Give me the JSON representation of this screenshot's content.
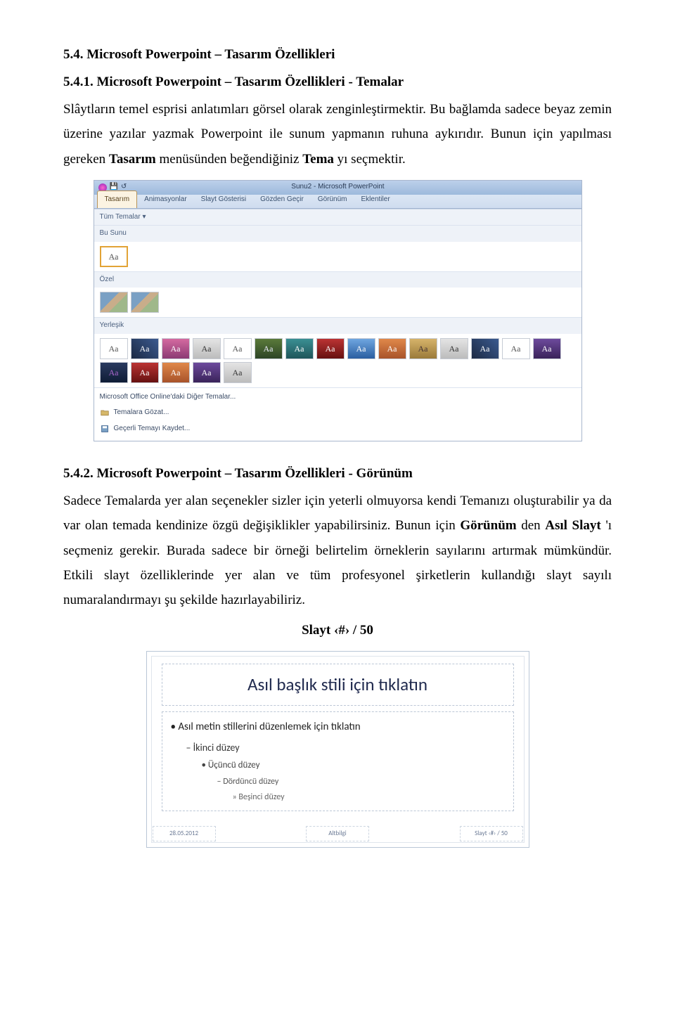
{
  "doc": {
    "h1": "5.4.   Microsoft Powerpoint – Tasarım Özellikleri",
    "h2a": "5.4.1.   Microsoft Powerpoint – Tasarım Özellikleri - Temalar",
    "p1a": "Slâytların temel esprisi anlatımları görsel olarak zenginleştirmektir. Bu bağlamda sadece beyaz zemin üzerine yazılar yazmak Powerpoint ile sunum yapmanın ruhuna aykırıdır. Bunun için yapılması gereken ",
    "p1b": "Tasarım",
    "p1c": " menüsünden beğendiğiniz ",
    "p1d": "Tema",
    "p1e": "yı seçmektir.",
    "h2b": "5.4.2.   Microsoft Powerpoint – Tasarım Özellikleri - Görünüm",
    "p2a": "Sadece Temalarda yer alan seçenekler sizler için yeterli olmuyorsa kendi Temanızı oluşturabilir ya da var olan temada kendinize özgü değişiklikler yapabilirsiniz. Bunun için ",
    "p2b": "Görünüm",
    "p2c": "den ",
    "p2d": "Asıl Slayt",
    "p2e": "'ı seçmeniz gerekir. Burada sadece bir örneği belirtelim örneklerin sayılarını artırmak mümkündür. Etkili slayt özelliklerinde yer alan ve tüm profesyonel şirketlerin kullandığı slayt sayılı numaralandırmayı şu şekilde hazırlayabiliriz.",
    "centerLabel": "Slayt ‹#› / 50"
  },
  "pp": {
    "windowTitle": "Sunu2 - Microsoft PowerPoint",
    "tabs": [
      "Tasarım",
      "Animasyonlar",
      "Slayt Gösterisi",
      "Gözden Geçir",
      "Görünüm",
      "Eklentiler"
    ],
    "groupAll": "Tüm Temalar ▾",
    "groupThis": "Bu Sunu",
    "groupCustom": "Özel",
    "groupBuiltin": "Yerleşik",
    "footerOnline": "Microsoft Office Online'daki Diğer Temalar...",
    "footerBrowse": "Temalara Gözat...",
    "footerSave": "Geçerli Temayı Kaydet...",
    "aaLabel": "Aa"
  },
  "slide": {
    "title": "Asıl başlık stili için tıklatın",
    "l1": "Asıl metin stillerini düzenlemek için tıklatın",
    "l2": "İkinci düzey",
    "l3": "Üçüncü düzey",
    "l4": "Dördüncü düzey",
    "l5": "Beşinci düzey",
    "date": "28.05.2012",
    "footer": "Altbilgi",
    "num": "Slayt ‹#› / 50"
  }
}
